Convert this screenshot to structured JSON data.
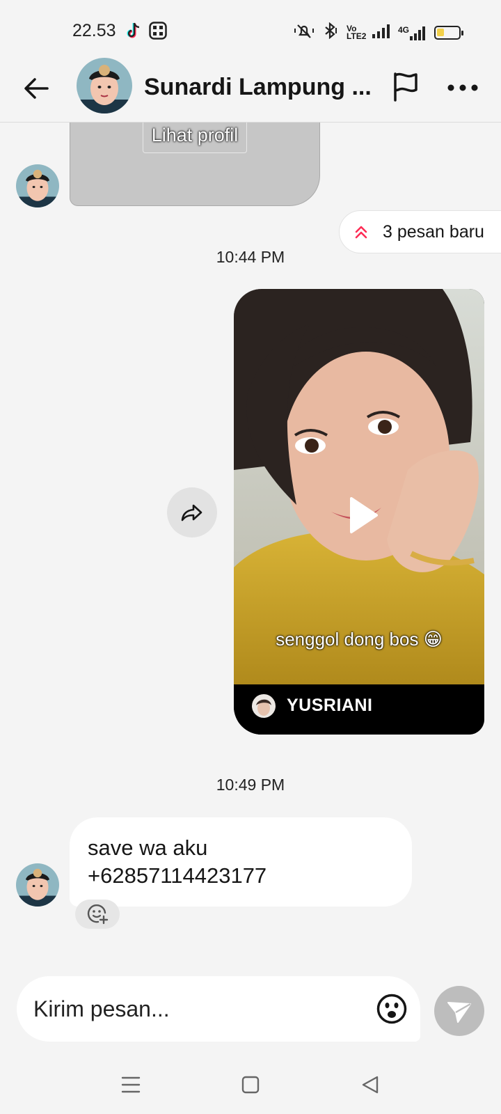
{
  "status_bar": {
    "time": "22.53",
    "app_icons": [
      "tiktok-icon",
      "grid-app-icon"
    ],
    "right_icons": [
      "mute-icon",
      "bluetooth-icon",
      "volte-icon",
      "signal-icon",
      "4g-signal-icon",
      "battery-icon"
    ],
    "network_label": "4G",
    "volte_label": "Vo LTE2",
    "battery_level": 0.3
  },
  "header": {
    "name": "Sunardi Lampung ...",
    "back_icon": "arrow-left-icon",
    "flag_icon": "flag-icon",
    "more_icon": "more-horizontal-icon"
  },
  "chat": {
    "profile_card": {
      "button_label": "Lihat profil"
    },
    "new_messages": {
      "label": "3 pesan baru",
      "icon": "double-chevron-up-icon",
      "accent": "#fe2c55"
    },
    "timestamps": [
      "10:44 PM",
      "10:49 PM"
    ],
    "video": {
      "caption": "senggol dong bos 😁",
      "author": "YUSRIANI",
      "share_icon": "share-arrow-icon",
      "play_icon": "play-icon"
    },
    "message": {
      "lines": [
        "save wa aku",
        "+62857114423177"
      ],
      "react_icon": "add-reaction-icon"
    }
  },
  "composer": {
    "placeholder": "Kirim pesan...",
    "emoji_icon": "emoji-icon",
    "send_icon": "send-icon"
  },
  "nav": {
    "icons": [
      "menu-icon",
      "home-square-icon",
      "back-triangle-icon"
    ]
  }
}
